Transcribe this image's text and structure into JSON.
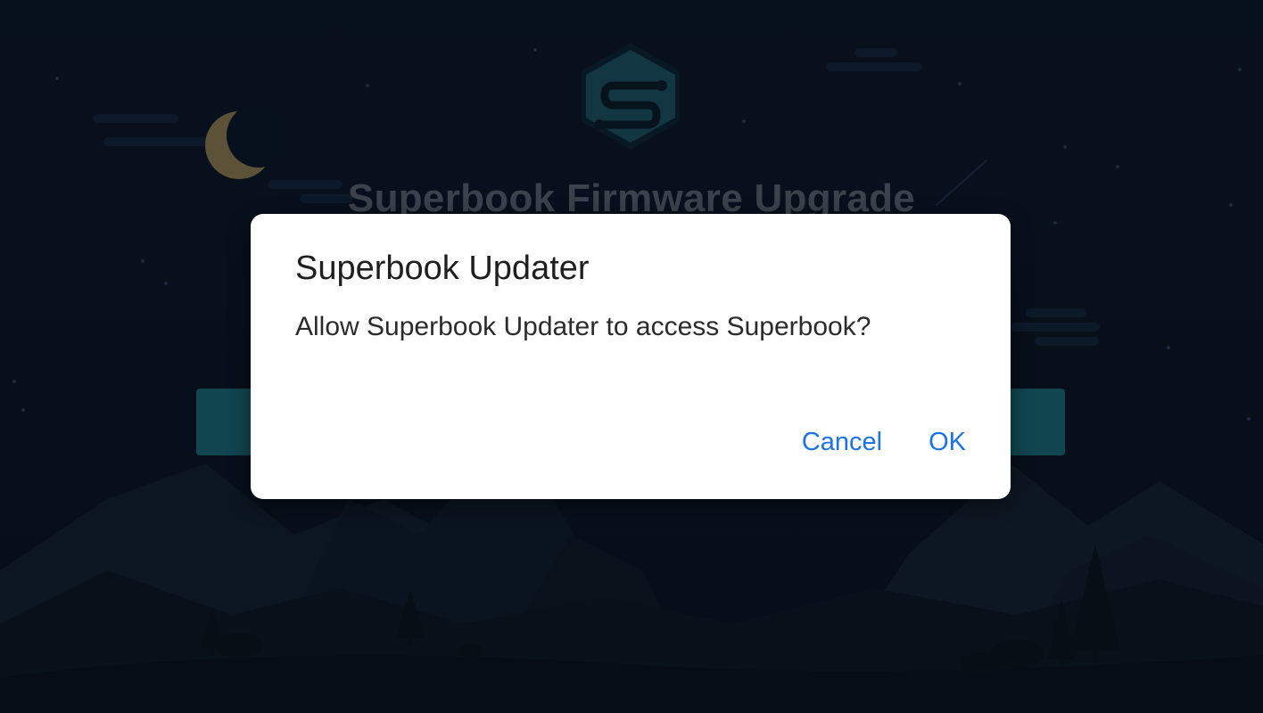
{
  "background_app": {
    "title": "Superbook Firmware Upgrade",
    "logo_icon": "superbook-hexagon-logo",
    "moon_icon": "crescent-moon",
    "accent_color": "#1b6b7a"
  },
  "dialog": {
    "title": "Superbook Updater",
    "message": "Allow Superbook Updater to access Superbook?",
    "cancel_label": "Cancel",
    "ok_label": "OK",
    "button_color": "#1a73e8"
  }
}
